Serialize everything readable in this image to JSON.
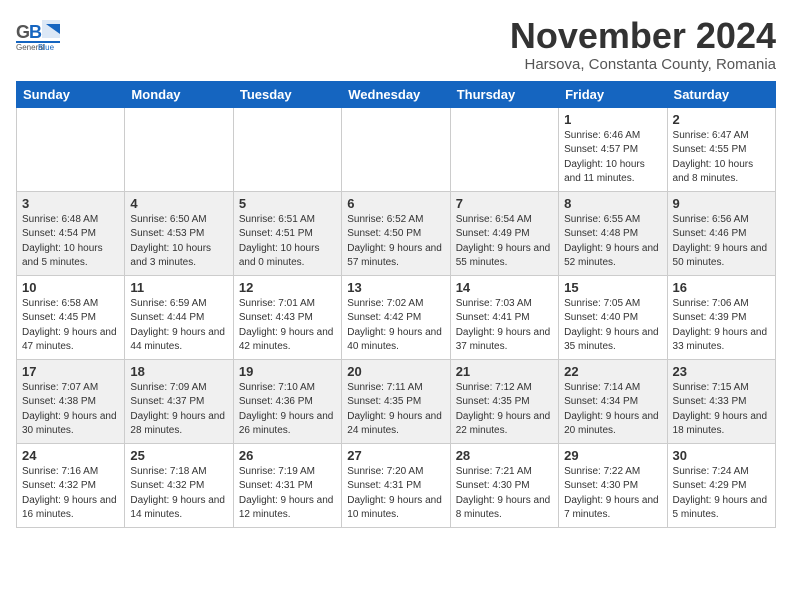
{
  "header": {
    "logo_general": "General",
    "logo_blue": "Blue",
    "month_title": "November 2024",
    "location": "Harsova, Constanta County, Romania"
  },
  "weekdays": [
    "Sunday",
    "Monday",
    "Tuesday",
    "Wednesday",
    "Thursday",
    "Friday",
    "Saturday"
  ],
  "weeks": [
    [
      {
        "day": "",
        "info": ""
      },
      {
        "day": "",
        "info": ""
      },
      {
        "day": "",
        "info": ""
      },
      {
        "day": "",
        "info": ""
      },
      {
        "day": "",
        "info": ""
      },
      {
        "day": "1",
        "info": "Sunrise: 6:46 AM\nSunset: 4:57 PM\nDaylight: 10 hours and 11 minutes."
      },
      {
        "day": "2",
        "info": "Sunrise: 6:47 AM\nSunset: 4:55 PM\nDaylight: 10 hours and 8 minutes."
      }
    ],
    [
      {
        "day": "3",
        "info": "Sunrise: 6:48 AM\nSunset: 4:54 PM\nDaylight: 10 hours and 5 minutes."
      },
      {
        "day": "4",
        "info": "Sunrise: 6:50 AM\nSunset: 4:53 PM\nDaylight: 10 hours and 3 minutes."
      },
      {
        "day": "5",
        "info": "Sunrise: 6:51 AM\nSunset: 4:51 PM\nDaylight: 10 hours and 0 minutes."
      },
      {
        "day": "6",
        "info": "Sunrise: 6:52 AM\nSunset: 4:50 PM\nDaylight: 9 hours and 57 minutes."
      },
      {
        "day": "7",
        "info": "Sunrise: 6:54 AM\nSunset: 4:49 PM\nDaylight: 9 hours and 55 minutes."
      },
      {
        "day": "8",
        "info": "Sunrise: 6:55 AM\nSunset: 4:48 PM\nDaylight: 9 hours and 52 minutes."
      },
      {
        "day": "9",
        "info": "Sunrise: 6:56 AM\nSunset: 4:46 PM\nDaylight: 9 hours and 50 minutes."
      }
    ],
    [
      {
        "day": "10",
        "info": "Sunrise: 6:58 AM\nSunset: 4:45 PM\nDaylight: 9 hours and 47 minutes."
      },
      {
        "day": "11",
        "info": "Sunrise: 6:59 AM\nSunset: 4:44 PM\nDaylight: 9 hours and 44 minutes."
      },
      {
        "day": "12",
        "info": "Sunrise: 7:01 AM\nSunset: 4:43 PM\nDaylight: 9 hours and 42 minutes."
      },
      {
        "day": "13",
        "info": "Sunrise: 7:02 AM\nSunset: 4:42 PM\nDaylight: 9 hours and 40 minutes."
      },
      {
        "day": "14",
        "info": "Sunrise: 7:03 AM\nSunset: 4:41 PM\nDaylight: 9 hours and 37 minutes."
      },
      {
        "day": "15",
        "info": "Sunrise: 7:05 AM\nSunset: 4:40 PM\nDaylight: 9 hours and 35 minutes."
      },
      {
        "day": "16",
        "info": "Sunrise: 7:06 AM\nSunset: 4:39 PM\nDaylight: 9 hours and 33 minutes."
      }
    ],
    [
      {
        "day": "17",
        "info": "Sunrise: 7:07 AM\nSunset: 4:38 PM\nDaylight: 9 hours and 30 minutes."
      },
      {
        "day": "18",
        "info": "Sunrise: 7:09 AM\nSunset: 4:37 PM\nDaylight: 9 hours and 28 minutes."
      },
      {
        "day": "19",
        "info": "Sunrise: 7:10 AM\nSunset: 4:36 PM\nDaylight: 9 hours and 26 minutes."
      },
      {
        "day": "20",
        "info": "Sunrise: 7:11 AM\nSunset: 4:35 PM\nDaylight: 9 hours and 24 minutes."
      },
      {
        "day": "21",
        "info": "Sunrise: 7:12 AM\nSunset: 4:35 PM\nDaylight: 9 hours and 22 minutes."
      },
      {
        "day": "22",
        "info": "Sunrise: 7:14 AM\nSunset: 4:34 PM\nDaylight: 9 hours and 20 minutes."
      },
      {
        "day": "23",
        "info": "Sunrise: 7:15 AM\nSunset: 4:33 PM\nDaylight: 9 hours and 18 minutes."
      }
    ],
    [
      {
        "day": "24",
        "info": "Sunrise: 7:16 AM\nSunset: 4:32 PM\nDaylight: 9 hours and 16 minutes."
      },
      {
        "day": "25",
        "info": "Sunrise: 7:18 AM\nSunset: 4:32 PM\nDaylight: 9 hours and 14 minutes."
      },
      {
        "day": "26",
        "info": "Sunrise: 7:19 AM\nSunset: 4:31 PM\nDaylight: 9 hours and 12 minutes."
      },
      {
        "day": "27",
        "info": "Sunrise: 7:20 AM\nSunset: 4:31 PM\nDaylight: 9 hours and 10 minutes."
      },
      {
        "day": "28",
        "info": "Sunrise: 7:21 AM\nSunset: 4:30 PM\nDaylight: 9 hours and 8 minutes."
      },
      {
        "day": "29",
        "info": "Sunrise: 7:22 AM\nSunset: 4:30 PM\nDaylight: 9 hours and 7 minutes."
      },
      {
        "day": "30",
        "info": "Sunrise: 7:24 AM\nSunset: 4:29 PM\nDaylight: 9 hours and 5 minutes."
      }
    ]
  ]
}
